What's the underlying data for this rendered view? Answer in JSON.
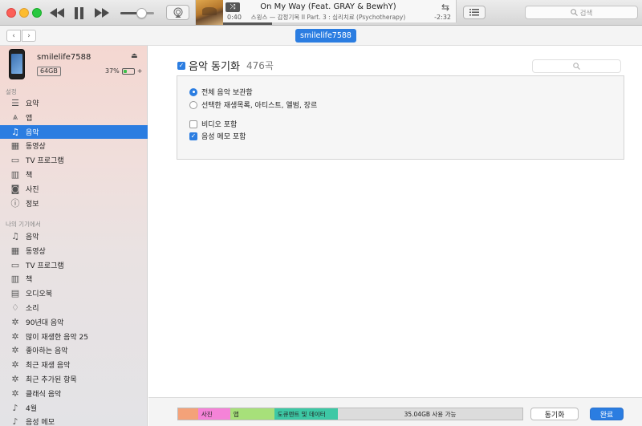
{
  "player": {
    "song_title": "On My Way (Feat. GRAY & BewhY)",
    "song_artist": "스윙스 — 감정기복 II Part. 3 : 심리치료 (Psychotherapy)",
    "elapsed": "0:40",
    "remaining": "-2:32",
    "progress": 0.21,
    "volume": 0.62
  },
  "search": {
    "placeholder": "검색"
  },
  "nav": {
    "device_label": "smilelife7588"
  },
  "device": {
    "name": "smilelife7588",
    "capacity": "64GB",
    "battery": "37%",
    "battery_level": 0.37
  },
  "sidebar": {
    "settings_label": "설정",
    "settings_items": [
      {
        "label": "요약",
        "icon": "summary-icon"
      },
      {
        "label": "앱",
        "icon": "apps-icon"
      },
      {
        "label": "음악",
        "icon": "music-note-icon",
        "active": true
      },
      {
        "label": "동영상",
        "icon": "film-icon"
      },
      {
        "label": "TV 프로그램",
        "icon": "tv-icon"
      },
      {
        "label": "책",
        "icon": "book-icon"
      },
      {
        "label": "사진",
        "icon": "camera-icon"
      },
      {
        "label": "정보",
        "icon": "info-icon"
      }
    ],
    "mydevice_label": "나의 기기에서",
    "device_items": [
      {
        "label": "음악",
        "icon": "music-note-icon"
      },
      {
        "label": "동영상",
        "icon": "film-icon"
      },
      {
        "label": "TV 프로그램",
        "icon": "tv-icon"
      },
      {
        "label": "책",
        "icon": "book-icon"
      },
      {
        "label": "오디오북",
        "icon": "audiobook-icon"
      },
      {
        "label": "소리",
        "icon": "bell-icon"
      },
      {
        "label": "90년대 음악",
        "icon": "gear-icon"
      },
      {
        "label": "많이 재생한 음악 25",
        "icon": "gear-icon"
      },
      {
        "label": "좋아하는 음악",
        "icon": "gear-icon"
      },
      {
        "label": "최근 재생 음악",
        "icon": "gear-icon"
      },
      {
        "label": "최근 추가된 항목",
        "icon": "gear-icon"
      },
      {
        "label": "클래식 음악",
        "icon": "gear-icon"
      },
      {
        "label": "4월",
        "icon": "playlist-icon"
      },
      {
        "label": "음성 메모",
        "icon": "playlist-icon"
      }
    ]
  },
  "main": {
    "sync_title": "음악 동기화",
    "sync_count": "476곡",
    "options": {
      "entire_library": "전체 음악 보관함",
      "selected": "선택한 재생목록, 아티스트, 앨범, 장르",
      "include_videos": "비디오 포함",
      "include_voice_memos": "음성 메모 포함"
    }
  },
  "storage": {
    "segments": [
      {
        "label": "",
        "color": "#f4a279",
        "fraction": 0.058
      },
      {
        "label": "사진",
        "color": "#f583d8",
        "fraction": 0.093
      },
      {
        "label": "앱",
        "color": "#a7e07a",
        "fraction": 0.128
      },
      {
        "label": "도큐멘트 및 데이터",
        "color": "#3dc8a5",
        "fraction": 0.185
      },
      {
        "label": "35.04GB 사용 가능",
        "color": "#dcdcdc",
        "fraction": 0.536,
        "free": true
      }
    ]
  },
  "buttons": {
    "sync": "동기화",
    "done": "완료"
  }
}
